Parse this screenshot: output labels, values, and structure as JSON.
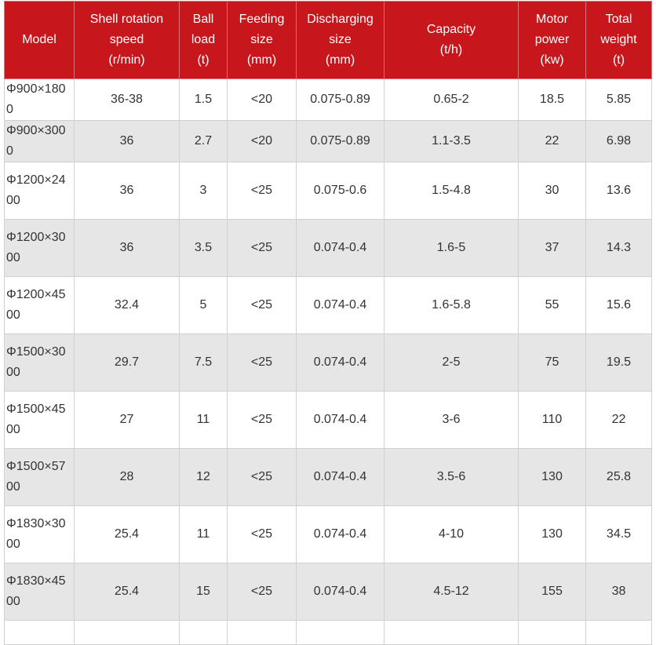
{
  "table": {
    "headers": [
      {
        "line1": "Model",
        "line2": "",
        "line3": ""
      },
      {
        "line1": "Shell rotation",
        "line2": "speed",
        "line3": "(r/min)"
      },
      {
        "line1": "Ball",
        "line2": "load",
        "line3": "(t)"
      },
      {
        "line1": "Feeding",
        "line2": "size",
        "line3": "(mm)"
      },
      {
        "line1": "Discharging",
        "line2": "size",
        "line3": "(mm)"
      },
      {
        "line1": "Capacity",
        "line2": "(t/h)",
        "line3": ""
      },
      {
        "line1": "Motor",
        "line2": "power",
        "line3": "(kw)"
      },
      {
        "line1": "Total",
        "line2": "weight",
        "line3": "(t)"
      }
    ],
    "rows": [
      [
        "Φ900×1800",
        "36-38",
        "1.5",
        "<20",
        "0.075-0.89",
        "0.65-2",
        "18.5",
        "5.85"
      ],
      [
        "Φ900×3000",
        "36",
        "2.7",
        "<20",
        "0.075-0.89",
        "1.1-3.5",
        "22",
        "6.98"
      ],
      [
        "Φ1200×2400",
        "36",
        "3",
        "<25",
        "0.075-0.6",
        "1.5-4.8",
        "30",
        "13.6"
      ],
      [
        "Φ1200×3000",
        "36",
        "3.5",
        "<25",
        "0.074-0.4",
        "1.6-5",
        "37",
        "14.3"
      ],
      [
        "Φ1200×4500",
        "32.4",
        "5",
        "<25",
        "0.074-0.4",
        "1.6-5.8",
        "55",
        "15.6"
      ],
      [
        "Φ1500×3000",
        "29.7",
        "7.5",
        "<25",
        "0.074-0.4",
        "2-5",
        "75",
        "19.5"
      ],
      [
        "Φ1500×4500",
        "27",
        "11",
        "<25",
        "0.074-0.4",
        "3-6",
        "110",
        "22"
      ],
      [
        "Φ1500×5700",
        "28",
        "12",
        "<25",
        "0.074-0.4",
        "3.5-6",
        "130",
        "25.8"
      ],
      [
        "Φ1830×3000",
        "25.4",
        "11",
        "<25",
        "0.074-0.4",
        "4-10",
        "130",
        "34.5"
      ],
      [
        "Φ1830×4500",
        "25.4",
        "15",
        "<25",
        "0.074-0.4",
        "4.5-12",
        "155",
        "38"
      ],
      [
        "",
        "",
        "",
        "",
        "",
        "",
        "",
        ""
      ]
    ]
  },
  "colors": {
    "header_bg": "#c8161d",
    "header_text": "#ffffff",
    "stripe_bg": "#e6e6e6",
    "border": "#d0d0d0"
  }
}
